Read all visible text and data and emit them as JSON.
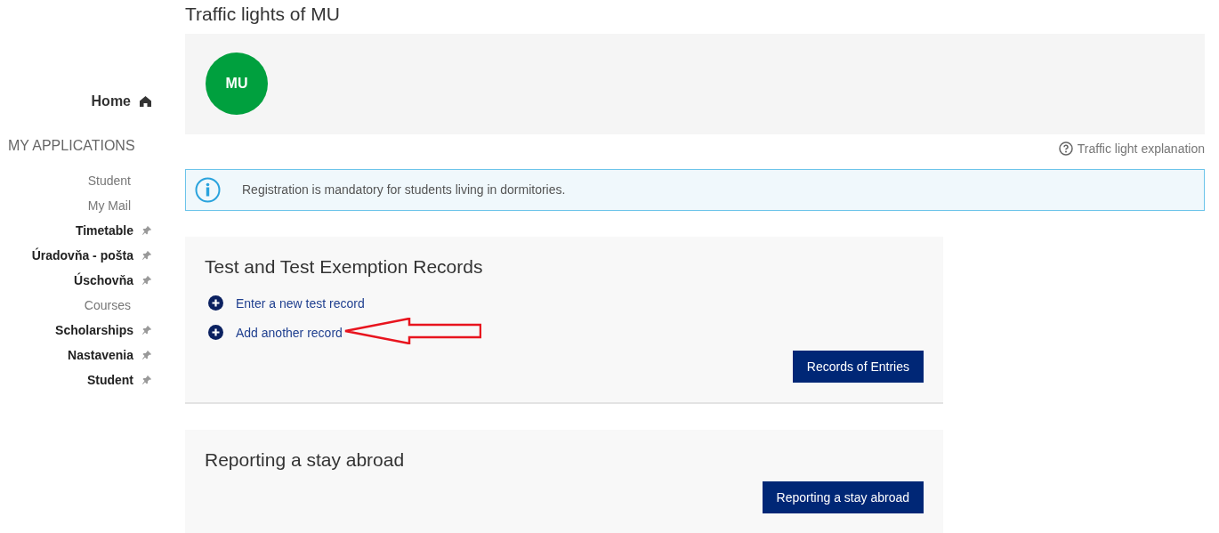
{
  "page_title": "Traffic lights of MU",
  "badge": {
    "text": "MU",
    "color": "#00a03e"
  },
  "sidebar": {
    "home": "Home",
    "section": "MY APPLICATIONS",
    "items": [
      {
        "label": "Student",
        "pinned": false
      },
      {
        "label": "My Mail",
        "pinned": false
      },
      {
        "label": "Timetable",
        "pinned": true
      },
      {
        "label": "Úradovňa - pošta",
        "pinned": true
      },
      {
        "label": "Úschovňa",
        "pinned": true
      },
      {
        "label": "Courses",
        "pinned": false
      },
      {
        "label": "Scholarships",
        "pinned": true
      },
      {
        "label": "Nastavenia",
        "pinned": true
      },
      {
        "label": "Student",
        "pinned": true
      }
    ]
  },
  "explanation_link": "Traffic light explanation",
  "notice": "Registration is mandatory for students living in dormitories.",
  "cards": [
    {
      "title": "Test and Test Exemption Records",
      "links": [
        {
          "label": "Enter a new test record",
          "annotated": false
        },
        {
          "label": "Add another record",
          "annotated": true
        }
      ],
      "button": "Records of Entries"
    },
    {
      "title": "Reporting a stay abroad",
      "button": "Reporting a stay abroad"
    }
  ]
}
